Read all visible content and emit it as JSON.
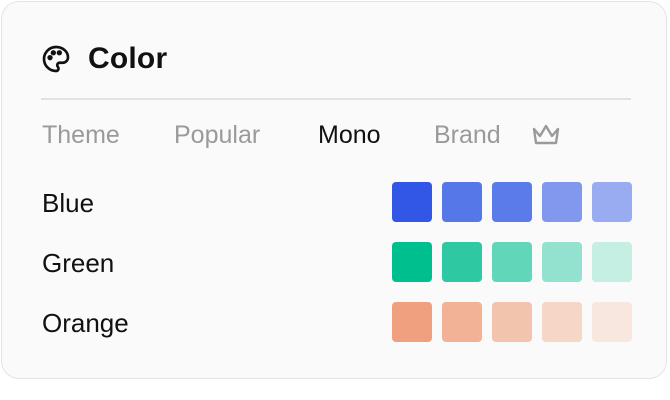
{
  "panel": {
    "title": "Color",
    "icon": "palette-icon"
  },
  "tabs": [
    {
      "label": "Theme",
      "active": false
    },
    {
      "label": "Popular",
      "active": false
    },
    {
      "label": "Mono",
      "active": true
    },
    {
      "label": "Brand",
      "active": false,
      "icon": "crown-icon"
    }
  ],
  "palettes": [
    {
      "name": "Blue",
      "swatches": [
        "#3256e6",
        "#5677e8",
        "#5b7bea",
        "#8298ef",
        "#9aacf1"
      ]
    },
    {
      "name": "Green",
      "swatches": [
        "#00bf8f",
        "#2ec9a2",
        "#62d6b9",
        "#93e2cf",
        "#c6efe4"
      ]
    },
    {
      "name": "Orange",
      "swatches": [
        "#f0a07e",
        "#f2b295",
        "#f3c4ad",
        "#f5d6c7",
        "#f8e7de"
      ]
    }
  ],
  "colors": {
    "active_tab": "#111111",
    "inactive_tab": "#9a9a9a",
    "panel_background": "#fafafa",
    "panel_border": "#e4e4e4"
  }
}
